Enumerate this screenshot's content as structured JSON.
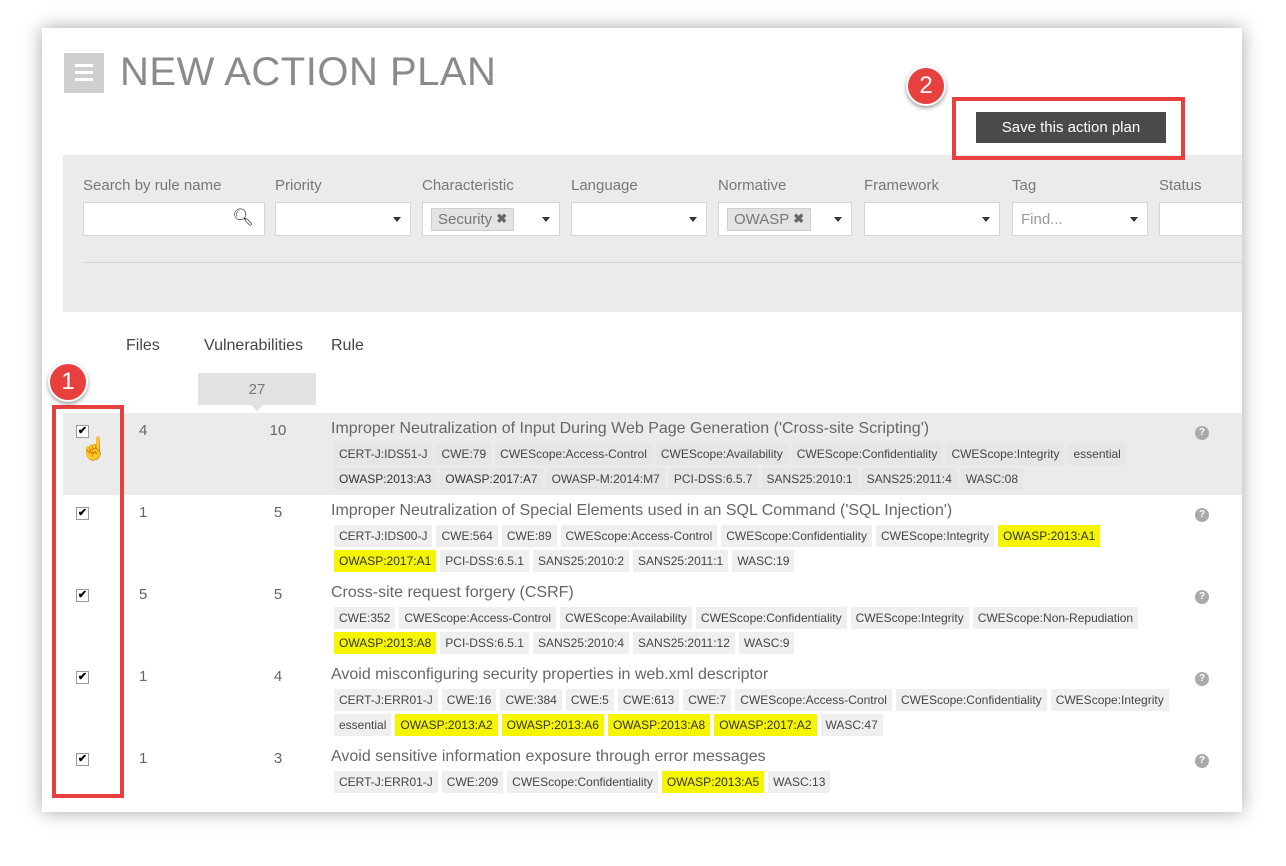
{
  "page": {
    "title": "NEW ACTION PLAN",
    "save_label": "Save this action plan"
  },
  "filters": [
    {
      "label": "Search by rule name",
      "value": "",
      "icon": "search-icon"
    },
    {
      "label": "Priority",
      "value": ""
    },
    {
      "label": "Characteristic",
      "chip": "Security"
    },
    {
      "label": "Language",
      "value": ""
    },
    {
      "label": "Normative",
      "chip": "OWASP"
    },
    {
      "label": "Framework",
      "value": ""
    },
    {
      "label": "Tag",
      "placeholder": "Find..."
    },
    {
      "label": "Status",
      "value": ""
    }
  ],
  "table": {
    "headers": {
      "files": "Files",
      "vulnerabilities": "Vulnerabilities",
      "rule": "Rule"
    },
    "total_vulnerabilities": "27",
    "rows": [
      {
        "checked": true,
        "files": "4",
        "vulns": "10",
        "title": "Improper Neutralization of Input During Web Page Generation ('Cross-site Scripting')",
        "tags": [
          "CERT-J:IDS51-J",
          "CWE:79",
          "CWEScope:Access-Control",
          "CWEScope:Availability",
          "CWEScope:Confidentiality",
          "CWEScope:Integrity",
          "essential",
          "OWASP:2013:A3",
          "OWASP:2017:A7",
          "OWASP-M:2014:M7",
          "PCI-DSS:6.5.7",
          "SANS25:2010:1",
          "SANS25:2011:4",
          "WASC:08"
        ],
        "highlight": [
          "OWASP:2013:A3",
          "OWASP:2017:A7"
        ]
      },
      {
        "checked": true,
        "files": "1",
        "vulns": "5",
        "title": "Improper Neutralization of Special Elements used in an SQL Command ('SQL Injection')",
        "tags": [
          "CERT-J:IDS00-J",
          "CWE:564",
          "CWE:89",
          "CWEScope:Access-Control",
          "CWEScope:Confidentiality",
          "CWEScope:Integrity",
          "OWASP:2013:A1",
          "OWASP:2017:A1",
          "PCI-DSS:6.5.1",
          "SANS25:2010:2",
          "SANS25:2011:1",
          "WASC:19"
        ],
        "highlight": [
          "OWASP:2013:A1",
          "OWASP:2017:A1"
        ]
      },
      {
        "checked": true,
        "files": "5",
        "vulns": "5",
        "title": "Cross-site request forgery (CSRF)",
        "tags": [
          "CWE:352",
          "CWEScope:Access-Control",
          "CWEScope:Availability",
          "CWEScope:Confidentiality",
          "CWEScope:Integrity",
          "CWEScope:Non-Repudiation",
          "OWASP:2013:A8",
          "PCI-DSS:6.5.1",
          "SANS25:2010:4",
          "SANS25:2011:12",
          "WASC:9"
        ],
        "highlight": [
          "OWASP:2013:A8"
        ]
      },
      {
        "checked": true,
        "files": "1",
        "vulns": "4",
        "title": "Avoid misconfiguring security properties in web.xml descriptor",
        "tags": [
          "CERT-J:ERR01-J",
          "CWE:16",
          "CWE:384",
          "CWE:5",
          "CWE:613",
          "CWE:7",
          "CWEScope:Access-Control",
          "CWEScope:Confidentiality",
          "CWEScope:Integrity",
          "essential",
          "OWASP:2013:A2",
          "OWASP:2013:A6",
          "OWASP:2013:A8",
          "OWASP:2017:A2",
          "WASC:47"
        ],
        "highlight": [
          "OWASP:2013:A2",
          "OWASP:2013:A6",
          "OWASP:2013:A8",
          "OWASP:2017:A2"
        ]
      },
      {
        "checked": true,
        "files": "1",
        "vulns": "3",
        "title": "Avoid sensitive information exposure through error messages",
        "tags": [
          "CERT-J:ERR01-J",
          "CWE:209",
          "CWEScope:Confidentiality",
          "OWASP:2013:A5",
          "WASC:13"
        ],
        "highlight": [
          "OWASP:2013:A5"
        ]
      }
    ]
  },
  "annotations": {
    "badge1": "1",
    "badge2": "2"
  },
  "colors": {
    "annotation": "#e8403f",
    "highlight": "#f5f500",
    "button": "#4a4a4a"
  }
}
